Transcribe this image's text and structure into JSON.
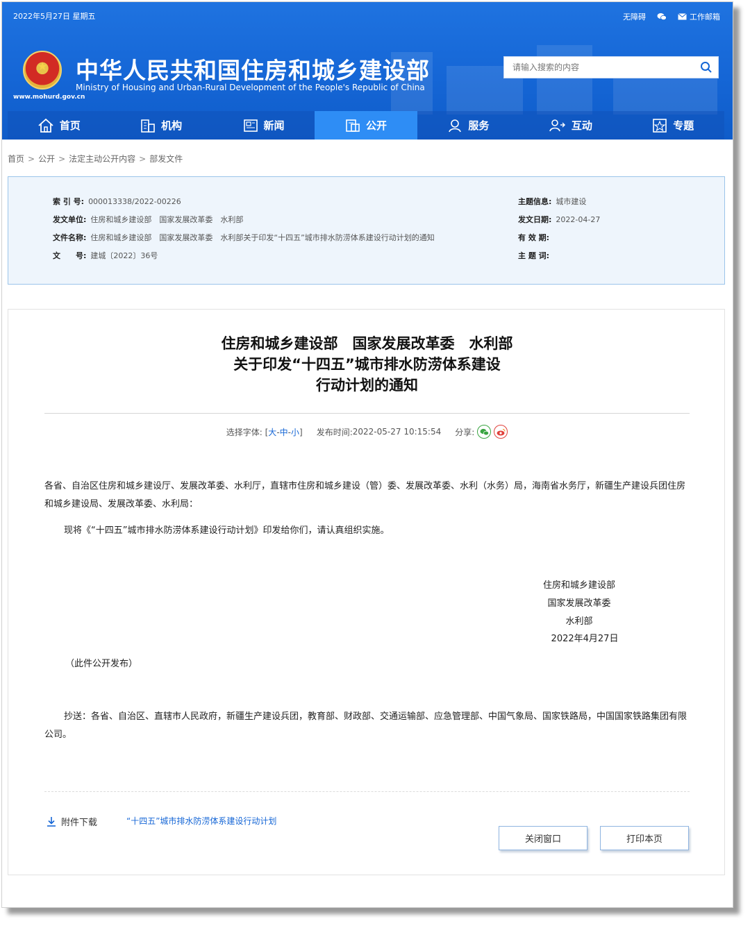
{
  "header": {
    "date": "2022年5月27日 星期五",
    "links": {
      "accessibility": "无障碍",
      "mail": "工作邮箱"
    },
    "title": "中华人民共和国住房和城乡建设部",
    "subtitle": "Ministry of Housing and Urban-Rural Development of the People's Republic of China",
    "url": "www.mohurd.gov.cn",
    "search": {
      "placeholder": "请输入搜索的内容"
    },
    "nav": [
      {
        "label": "首页",
        "icon": "home-icon"
      },
      {
        "label": "机构",
        "icon": "building-icon"
      },
      {
        "label": "新闻",
        "icon": "news-icon"
      },
      {
        "label": "公开",
        "icon": "document-icon",
        "active": true
      },
      {
        "label": "服务",
        "icon": "user-service-icon"
      },
      {
        "label": "互动",
        "icon": "interact-icon"
      },
      {
        "label": "专题",
        "icon": "star-icon"
      }
    ]
  },
  "breadcrumb": [
    "首页",
    "公开",
    "法定主动公开内容",
    "部发文件"
  ],
  "info": {
    "index_label": "索 引 号:",
    "index_value": "000013338/2022-00226",
    "issuer_label": "发文单位:",
    "issuer_value": "住房和城乡建设部　国家发展改革委　水利部",
    "doc_label": "文件名称:",
    "doc_value": "住房和城乡建设部　国家发展改革委　水利部关于印发“十四五”城市排水防涝体系建设行动计划的通知",
    "num_label": "文　　号:",
    "num_value": "建城〔2022〕36号",
    "topic_label": "主题信息:",
    "topic_value": "城市建设",
    "date_label": "发文日期:",
    "date_value": "2022-04-27",
    "validity_label": "有 效 期:",
    "validity_value": "",
    "keywords_label": "主 题 词:",
    "keywords_value": ""
  },
  "article": {
    "title_lines": [
      "住房和城乡建设部　国家发展改革委　水利部",
      "关于印发“十四五”城市排水防涝体系建设",
      "行动计划的通知"
    ],
    "font_select_label": "选择字体:",
    "font_bracket_open": "[",
    "font_large": "大",
    "font_medium": "中",
    "font_small": "小",
    "font_bracket_close": "]",
    "font_dash": "-",
    "publish_label": "发布时间:",
    "publish_time": "2022-05-27 10:15:54",
    "share_label": "分享:",
    "recipients": "各省、自治区住房和城乡建设厅、发展改革委、水利厅，直辖市住房和城乡建设（管）委、发展改革委、水利（水务）局，海南省水务厅，新疆生产建设兵团住房和城乡建设局、发展改革委、水利局：",
    "body": "现将《“十四五”城市排水防涝体系建设行动计划》印发给你们，请认真组织实施。",
    "sign_lines": [
      "住房和城乡建设部",
      "国家发展改革委",
      "水利部",
      "2022年4月27日"
    ],
    "public_note": "（此件公开发布）",
    "cc": "抄送：各省、自治区、直辖市人民政府，新疆生产建设兵团，教育部、财政部、交通运输部、应急管理部、中国气象局、国家铁路局，中国国家铁路集团有限公司。",
    "attachment_label": "附件下载",
    "attachment_link": "“十四五”城市排水防涝体系建设行动计划",
    "close_button": "关闭窗口",
    "print_button": "打印本页"
  }
}
